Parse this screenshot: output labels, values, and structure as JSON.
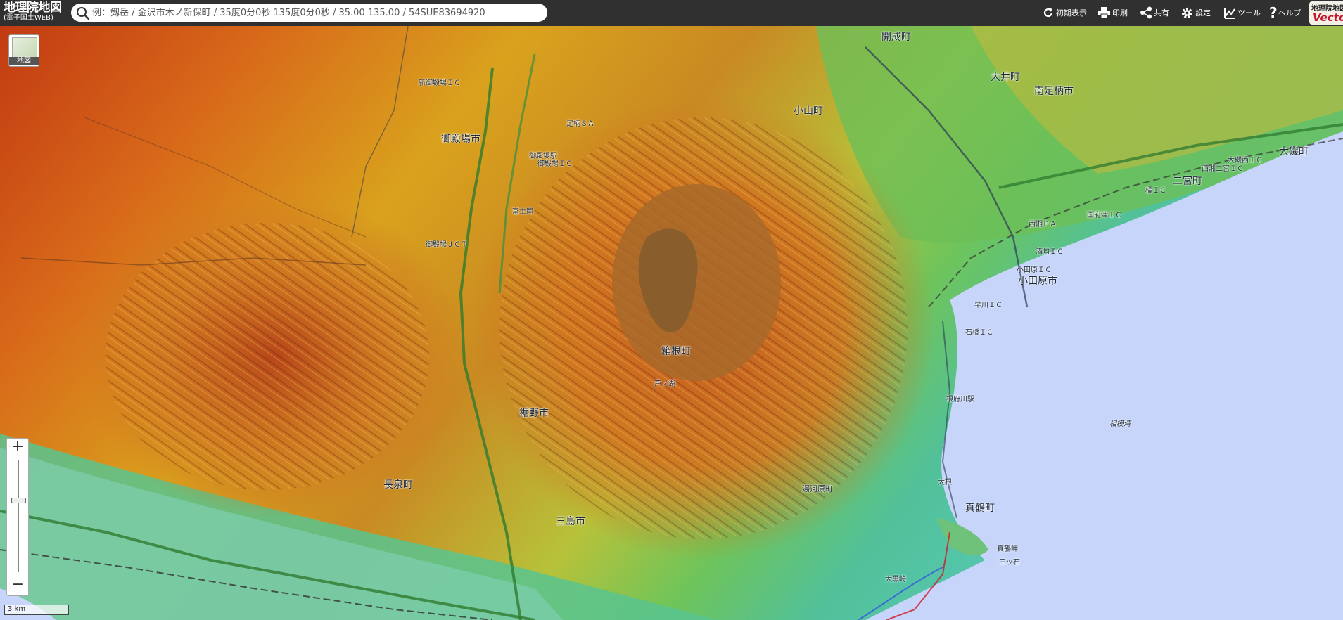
{
  "header": {
    "brand_title": "地理院地図",
    "brand_subtitle": "(電子国土WEB)",
    "search_placeholder": "例：剱岳 / 金沢市木ノ新保町 / 35度0分0秒 135度0分0秒 / 35.00 135.00 / 54SUE83694920",
    "toolbar": {
      "initial_view": "初期表示",
      "print": "印刷",
      "share": "共有",
      "settings": "設定",
      "tools": "ツール",
      "help": "ヘルプ"
    },
    "badge_line1": "地理院地図",
    "badge_line2": "Vector"
  },
  "map_controls": {
    "layer_button_label": "地図",
    "zoom_in": "+",
    "zoom_out": "−",
    "scale_label": "3 km"
  },
  "map_labels": {
    "gotemba_city": "御殿場市",
    "oyama_town": "小山町",
    "kaisei_town": "開成町",
    "oi_town": "大井町",
    "minamiashigara_city": "南足柄市",
    "hakone_town": "箱根町",
    "odawara_city": "小田原市",
    "ninomiya_town": "二宮町",
    "oiso_town": "大磯町",
    "susono_city": "裾野市",
    "nagaizumi_town": "長泉町",
    "mishima_city": "三島市",
    "manazuru_town": "真鶴町",
    "yugawara_town": "湯河原町",
    "sagami_bay": "相模湾",
    "manazuru_cape": "真鶴岬",
    "mitsuishi": "三ッ石",
    "oguro_cape": "大黒崎",
    "hayakawa_ic": "早川ＩＣ",
    "kozu_ic": "国府津ＩＣ",
    "sakawa_ic": "酒匂ＩＣ",
    "odawara_ic": "小田原ＩＣ",
    "ishibashi_ic": "石橋ＩＣ",
    "nebukawa_station": "根府川駅",
    "gotemba_ic": "御殿場ＩＣ",
    "gotemba_station": "御殿場駅",
    "gotemba_jct": "御殿場ＪＣＴ",
    "ashigara_sa": "足柄ＳＡ",
    "shingotemba_ic": "新御殿場ＩＣ",
    "fujioka": "富士岡",
    "ashinoko": "芦ノ湖",
    "kanagawa_chiba": "大根",
    "oiso_west_ic": "大磯西ＩＣ",
    "nishisho_ic": "西湘二宮ＩＣ",
    "tachibana_ic": "橘ＩＣ",
    "kozu_pa": "西湘ＰＡ"
  }
}
